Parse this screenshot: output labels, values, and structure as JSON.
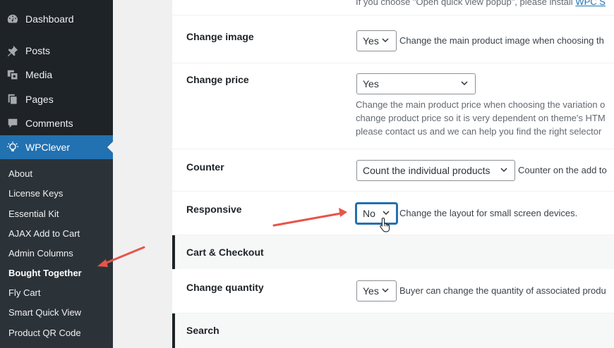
{
  "sidebar": {
    "items": [
      {
        "label": "Dashboard",
        "icon": "dashboard-icon"
      },
      {
        "label": "Posts",
        "icon": "pin-icon"
      },
      {
        "label": "Media",
        "icon": "media-icon"
      },
      {
        "label": "Pages",
        "icon": "pages-icon"
      },
      {
        "label": "Comments",
        "icon": "comments-icon"
      },
      {
        "label": "WPClever",
        "icon": "lightbulb-icon",
        "active": true
      }
    ],
    "submenu": [
      {
        "label": "About"
      },
      {
        "label": "License Keys"
      },
      {
        "label": "Essential Kit"
      },
      {
        "label": "AJAX Add to Cart"
      },
      {
        "label": "Admin Columns"
      },
      {
        "label": "Bought Together",
        "current": true
      },
      {
        "label": "Fly Cart"
      },
      {
        "label": "Smart Quick View"
      },
      {
        "label": "Product QR Code"
      }
    ]
  },
  "settings": {
    "top_note": "If you choose \"Open quick view popup\", please install",
    "top_link": "WPC S",
    "change_image": {
      "label": "Change image",
      "value": "Yes",
      "desc": "Change the main product image when choosing th"
    },
    "change_price": {
      "label": "Change price",
      "value": "Yes",
      "desc_lines": [
        "Change the main product price when choosing the variation o",
        "change product price so it is very dependent on theme's HTM",
        "please contact us and we can help you find the right selector"
      ]
    },
    "counter": {
      "label": "Counter",
      "value": "Count the individual products",
      "desc": "Counter on the add to"
    },
    "responsive": {
      "label": "Responsive",
      "value": "No",
      "desc": "Change the layout for small screen devices."
    },
    "section_cart": "Cart & Checkout",
    "change_quantity": {
      "label": "Change quantity",
      "value": "Yes",
      "desc": "Buyer can change the quantity of associated produ"
    },
    "section_search": "Search"
  },
  "colors": {
    "accent": "#2271b1",
    "annotation_arrow": "#e8544a",
    "sidebar_bg": "#1d2327"
  }
}
